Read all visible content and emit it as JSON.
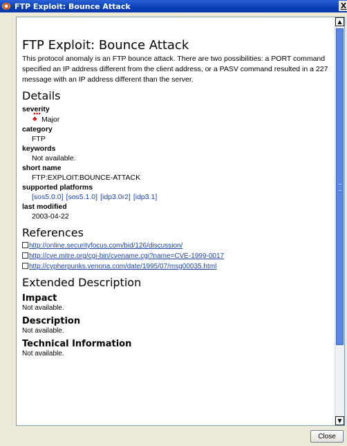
{
  "window": {
    "title": "FTP Exploit: Bounce Attack",
    "close_glyph": "X"
  },
  "page": {
    "heading": "FTP Exploit: Bounce Attack",
    "intro": "This protocol anomaly is an FTP bounce attack. There are two possibilities: a PORT command specified an IP address different from the client address, or a PASV command resulted in a 227 message with an IP address different than the server."
  },
  "details": {
    "heading": "Details",
    "severity_label": "severity",
    "severity_value": "Major",
    "category_label": "category",
    "category_value": "FTP",
    "keywords_label": "keywords",
    "keywords_value": "Not available.",
    "short_name_label": "short name",
    "short_name_value": "FTP:EXPLOIT:BOUNCE-ATTACK",
    "platforms_label": "supported platforms",
    "platforms": [
      "[sos5.0.0]",
      "[sos5.1.0]",
      "[idp3.0r2]",
      "[idp3.1]"
    ],
    "last_modified_label": "last modified",
    "last_modified_value": "2003-04-22"
  },
  "references": {
    "heading": "References",
    "links": [
      "http://online.securityfocus.com/bid/126/discussion/",
      "http://cve.mitre.org/cgi-bin/cvename.cgi?name=CVE-1999-0017",
      "http://cypherpunks.venona.com/date/1995/07/msg00035.html"
    ]
  },
  "extended": {
    "heading": "Extended Description",
    "impact_heading": "Impact",
    "impact_value": "Not available.",
    "description_heading": "Description",
    "description_value": "Not available.",
    "technical_heading": "Technical Information",
    "technical_value": "Not available."
  },
  "footer": {
    "close_label": "Close"
  },
  "icons": {
    "window_icon": "firewall-app-icon",
    "severity_icon": "major-severity-icon",
    "reference_icon": "link-box-icon"
  }
}
